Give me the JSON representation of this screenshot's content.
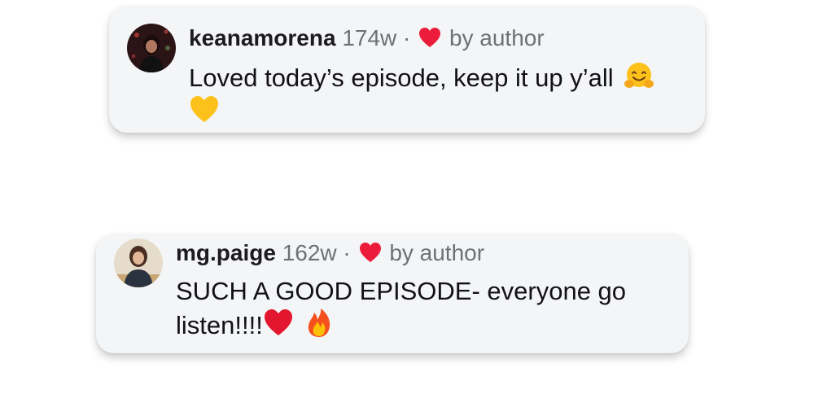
{
  "comments": [
    {
      "username": "keanamorena",
      "time": "174w",
      "separator": "·",
      "liked_by": "by author",
      "text": "Loved today’s episode, keep it up y’all",
      "emojis": [
        "hugging-face",
        "yellow-heart"
      ],
      "avatar_colors": [
        "#3a1c1e",
        "#7a2a2a"
      ]
    },
    {
      "username": "mg.paige",
      "time": "162w",
      "separator": "·",
      "liked_by": "by author",
      "text_line1": "SUCH A GOOD EPISODE- everyone go",
      "text_line2": "listen!!!!",
      "emojis": [
        "red-heart",
        "fire"
      ],
      "avatar_colors": [
        "#d8c7a8",
        "#2b3340"
      ]
    }
  ],
  "colors": {
    "card_bg": "#f4f5f6",
    "heart": "#ec1d3a",
    "meta_text": "#6e7076",
    "username": "#1c1c1e"
  }
}
